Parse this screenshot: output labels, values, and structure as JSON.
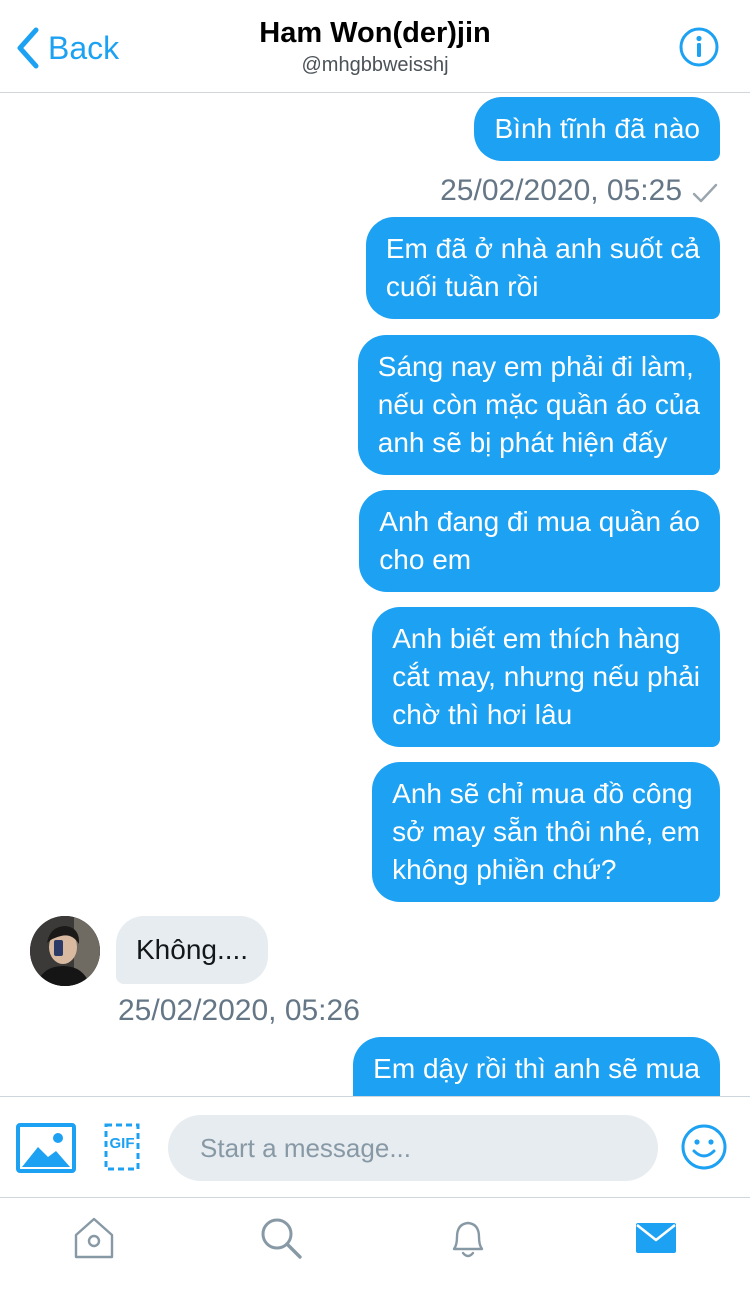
{
  "header": {
    "back_label": "Back",
    "title": "Ham Won(der)jin",
    "handle": "@mhgbbweisshj"
  },
  "messages": [
    {
      "from": "me",
      "text": "Bình tĩnh đã nào"
    },
    {
      "type": "timestamp",
      "text": "25/02/2020, 05:25",
      "status": "sent-check"
    },
    {
      "from": "me",
      "lines": [
        "Em đã ở nhà anh suốt cả",
        "cuối tuần rồi"
      ]
    },
    {
      "from": "me",
      "lines": [
        "Sáng nay em phải đi làm,",
        "nếu còn mặc quần áo của",
        "anh sẽ bị phát hiện đấy"
      ]
    },
    {
      "from": "me",
      "lines": [
        "Anh đang đi mua quần áo",
        "cho em"
      ]
    },
    {
      "from": "me",
      "lines": [
        "Anh biết em thích hàng",
        "cắt may, nhưng nếu phải",
        "chờ thì hơi lâu"
      ]
    },
    {
      "from": "me",
      "lines": [
        "Anh sẽ chỉ mua đồ công",
        "sở may sẵn thôi nhé, em",
        "không phiền chứ?"
      ]
    },
    {
      "from": "them",
      "text": "Không....",
      "avatar": "profile-photo"
    },
    {
      "type": "timestamp",
      "text": "25/02/2020, 05:26"
    },
    {
      "from": "me",
      "lines": [
        "Em dậy rồi thì anh sẽ mua"
      ]
    }
  ],
  "composer": {
    "placeholder": "Start a message...",
    "photo_icon": "image-icon",
    "gif_label": "GIF",
    "emoji_icon": "emoji-icon"
  },
  "tabbar": [
    {
      "name": "home",
      "icon": "home-icon",
      "active": false
    },
    {
      "name": "search",
      "icon": "search-icon",
      "active": false
    },
    {
      "name": "notifications",
      "icon": "bell-icon",
      "active": false
    },
    {
      "name": "messages",
      "icon": "mail-icon",
      "active": true
    }
  ],
  "colors": {
    "accent": "#1da1f2",
    "incoming_bubble": "#e6ecf0",
    "muted_text": "#657786",
    "inactive_icon": "#8899a6"
  }
}
